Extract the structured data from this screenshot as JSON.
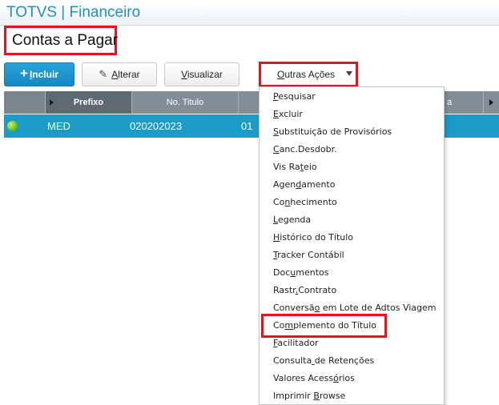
{
  "app": {
    "title": "TOTVS | Financeiro"
  },
  "page": {
    "title": "Contas a Pagar"
  },
  "toolbar": {
    "incluir": {
      "mnemonic": "I",
      "rest": "ncluir",
      "icon": "plus-icon"
    },
    "alterar": {
      "mnemonic": "A",
      "rest": "lterar",
      "icon": "pencil-icon"
    },
    "visualizar": {
      "mnemonic": "V",
      "rest": "isualizar"
    },
    "outras_acoes": {
      "mnemonic": "O",
      "rest": "utras Ações",
      "icon": "caret-down-icon"
    }
  },
  "grid": {
    "headers": {
      "prefixo": "Prefixo",
      "numero": "No. Titulo",
      "clipped": "a"
    },
    "rows": [
      {
        "status_color": "#6cbf19",
        "prefixo": "MED",
        "numero": "020202023",
        "next": "01"
      }
    ]
  },
  "menu": {
    "items": [
      {
        "pre": "",
        "u": "P",
        "post": "esquisar"
      },
      {
        "pre": "",
        "u": "E",
        "post": "xcluir"
      },
      {
        "pre": "",
        "u": "S",
        "post": "ubstituição de Provisórios"
      },
      {
        "pre": "",
        "u": "C",
        "post": "anc.Desdobr."
      },
      {
        "pre": "Vis Ra",
        "u": "t",
        "post": "eio"
      },
      {
        "pre": "Agen",
        "u": "d",
        "post": "amento"
      },
      {
        "pre": "Co",
        "u": "n",
        "post": "hecimento"
      },
      {
        "pre": "",
        "u": "L",
        "post": "egenda"
      },
      {
        "pre": "",
        "u": "H",
        "post": "istórico do Título"
      },
      {
        "pre": "",
        "u": "T",
        "post": "racker Contábil"
      },
      {
        "pre": "Doc",
        "u": "u",
        "post": "mentos"
      },
      {
        "pre": "Rastr",
        "u": ".",
        "post": "Contrato"
      },
      {
        "pre": "Conversã",
        "u": "o",
        "post": " em Lote de Adtos Viagem"
      },
      {
        "pre": "Co",
        "u": "m",
        "post": "plemento do Título"
      },
      {
        "pre": "",
        "u": "F",
        "post": "acilitador"
      },
      {
        "pre": "Consulta",
        "u": " ",
        "post": "de Retenções"
      },
      {
        "pre": "Valores Acess",
        "u": "ó",
        "post": "rios"
      },
      {
        "pre": "Imprimir ",
        "u": "B",
        "post": "rowse"
      }
    ]
  },
  "colors": {
    "accent": "#1f8fc9",
    "highlight_border": "#e8121f",
    "selected_row": "#1b9bc8",
    "header": "#828d95"
  }
}
